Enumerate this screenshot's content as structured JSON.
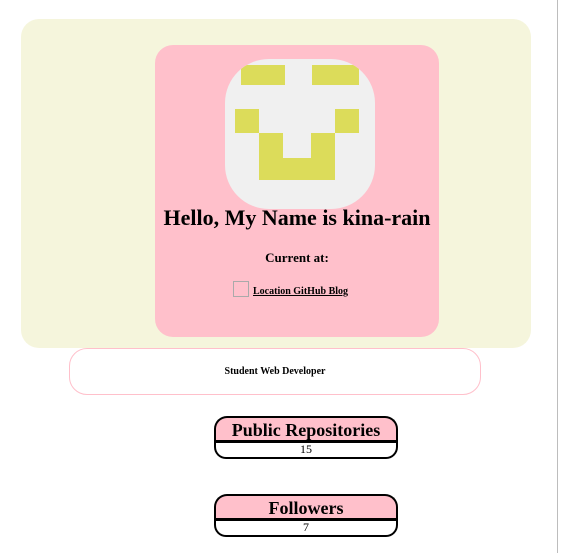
{
  "profile": {
    "greeting": "Hello, My Name is kina-rain",
    "current_label": "Current at:",
    "location_link": "Location GitHub Blog",
    "role": "Student Web Developer"
  },
  "stats": {
    "repos_label": "Public Repositories",
    "repos_value": "15",
    "followers_label": "Followers",
    "followers_value": "7"
  },
  "colors": {
    "banner": "#f5f5dc",
    "card": "#ffc0cb",
    "avatar_bg": "#f0f0f0",
    "avatar_pixels": "#dcdc5a"
  },
  "icons": {
    "avatar": "identicon-avatar",
    "location": "broken-image-icon"
  }
}
